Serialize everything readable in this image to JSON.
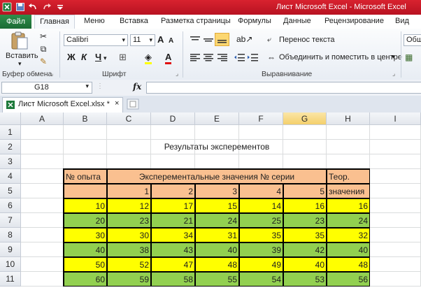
{
  "title_bar": {
    "text": "Лист Microsoft Excel  -  Microsoft Excel"
  },
  "ribbon_tabs": [
    "Файл",
    "Главная",
    "Меню",
    "Вставка",
    "Разметка страницы",
    "Формулы",
    "Данные",
    "Рецензирование",
    "Вид"
  ],
  "clipboard": {
    "paste_label": "Вставить",
    "group_label": "Буфер обмена"
  },
  "font": {
    "name": "Calibri",
    "size": "11",
    "group_label": "Шрифт",
    "bold": "Ж",
    "italic": "К",
    "underline": "Ч",
    "grow": "A",
    "shrink": "A"
  },
  "alignment": {
    "wrap_text": "Перенос текста",
    "merge_center": "Объединить и поместить в центре",
    "group_label": "Выравнивание"
  },
  "number": {
    "format": "Общ"
  },
  "formula_bar": {
    "name_box": "G18",
    "fx": "fx",
    "value": ""
  },
  "workbook_tab": {
    "name": "Лист Microsoft Excel.xlsx *"
  },
  "colors": {
    "header_orange": "#fac090",
    "yellow": "#ffff00",
    "green": "#92d050",
    "title_red": "#c8102e"
  },
  "sheet": {
    "columns": [
      "A",
      "B",
      "C",
      "D",
      "E",
      "F",
      "G",
      "H",
      "I"
    ],
    "selected_column": "G",
    "rows": [
      "1",
      "2",
      "3",
      "4",
      "5",
      "6",
      "7",
      "8",
      "9",
      "10",
      "11"
    ],
    "title": "Результаты эксперементов",
    "header": {
      "trial_no": "№ опыта",
      "experimental": "Эксперементальные значения № серии",
      "theory_1": "Теор.",
      "theory_2": "значения",
      "series": [
        "1",
        "2",
        "3",
        "4",
        "5"
      ]
    },
    "data": [
      [
        "10",
        "12",
        "17",
        "15",
        "14",
        "16",
        "16"
      ],
      [
        "20",
        "23",
        "21",
        "24",
        "25",
        "23",
        "24"
      ],
      [
        "30",
        "30",
        "34",
        "31",
        "35",
        "35",
        "32"
      ],
      [
        "40",
        "38",
        "43",
        "40",
        "39",
        "42",
        "40"
      ],
      [
        "50",
        "52",
        "47",
        "48",
        "49",
        "40",
        "48"
      ],
      [
        "60",
        "59",
        "58",
        "55",
        "54",
        "53",
        "56"
      ]
    ]
  }
}
